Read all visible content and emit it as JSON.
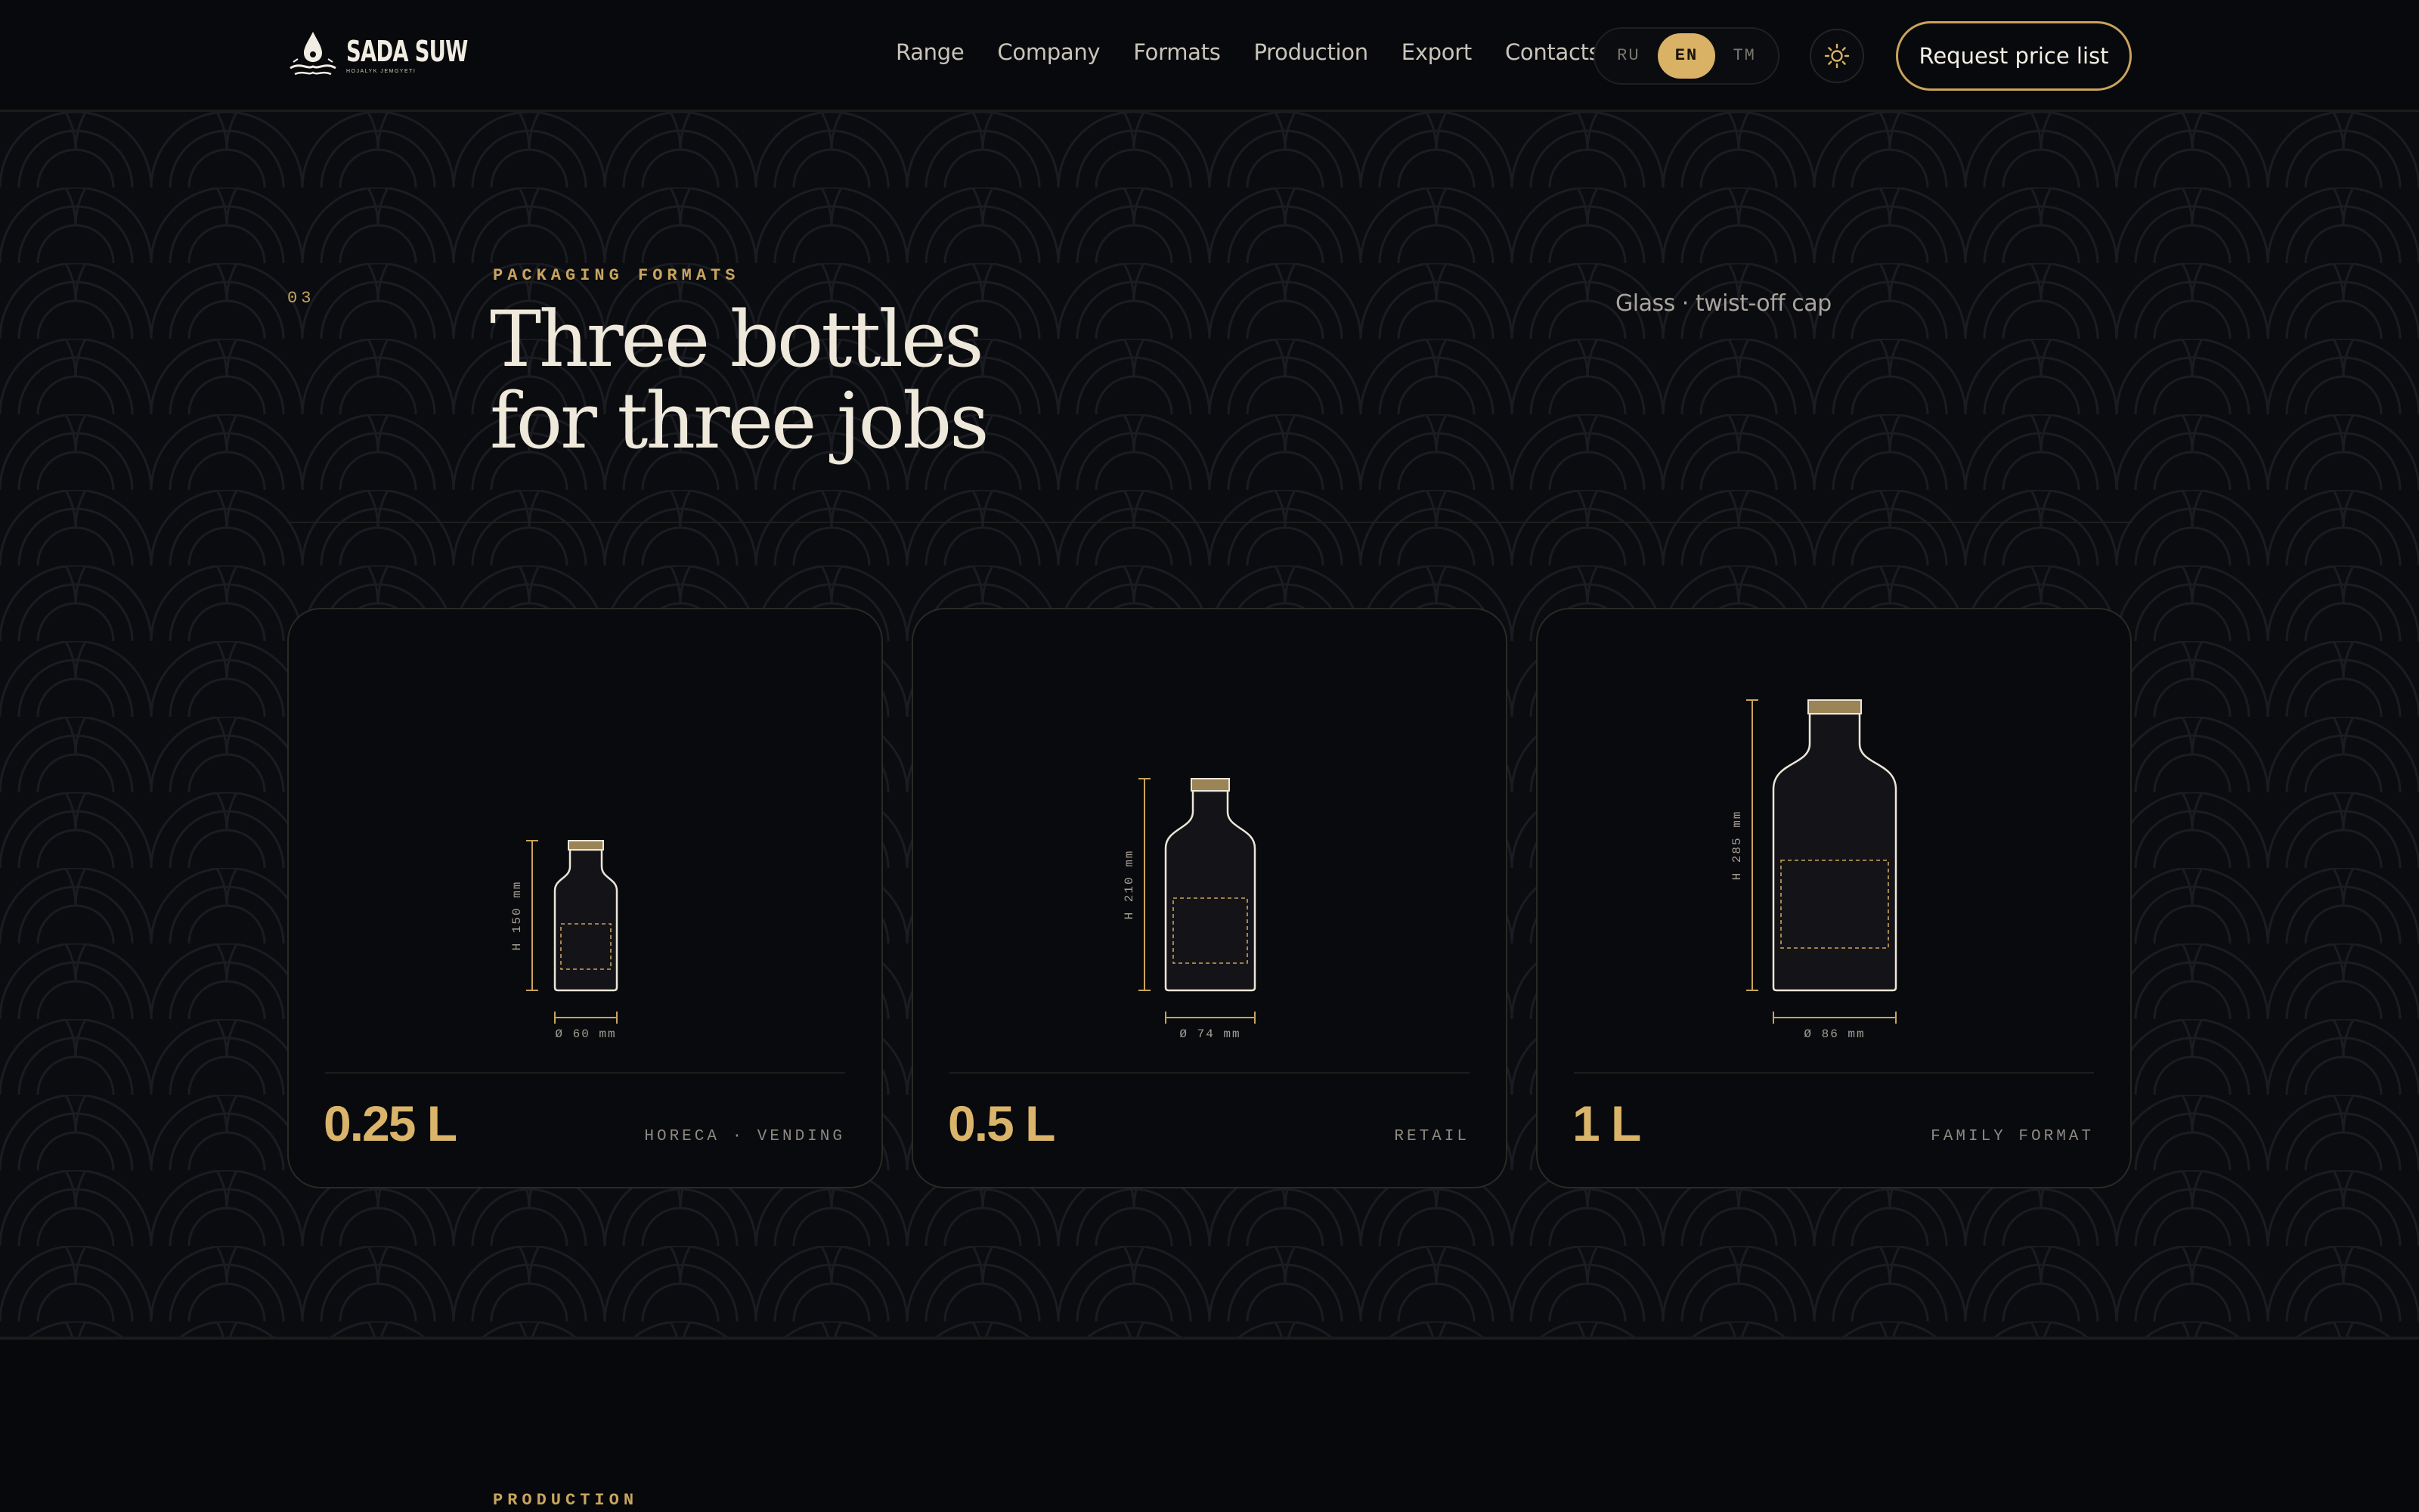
{
  "brand": {
    "name": "SADA SUW",
    "tagline": "HOJALYK JEMGYETI"
  },
  "nav": {
    "items": [
      {
        "label": "Range"
      },
      {
        "label": "Company"
      },
      {
        "label": "Formats"
      },
      {
        "label": "Production"
      },
      {
        "label": "Export"
      },
      {
        "label": "Contacts"
      }
    ]
  },
  "lang": {
    "options": [
      "RU",
      "EN",
      "TM"
    ],
    "active": "EN"
  },
  "theme_toggle": {
    "icon": "sun-icon"
  },
  "cta": {
    "label": "Request price list"
  },
  "section": {
    "number": "03",
    "eyebrow": "PACKAGING FORMATS",
    "title_line1": "Three bottles",
    "title_line2": "for three jobs",
    "note": "Glass · twist-off cap"
  },
  "formats": [
    {
      "volume": "0.25 L",
      "use": "HORECA · VENDING",
      "height_label": "H 150 mm",
      "diameter_label": "Ø 60 mm"
    },
    {
      "volume": "0.5 L",
      "use": "RETAIL",
      "height_label": "H 210 mm",
      "diameter_label": "Ø 74 mm"
    },
    {
      "volume": "1 L",
      "use": "FAMILY FORMAT",
      "height_label": "H 285 mm",
      "diameter_label": "Ø 86 mm"
    }
  ],
  "next_section": {
    "eyebrow": "PRODUCTION"
  },
  "colors": {
    "accent": "#d9b266",
    "background": "#08090c",
    "text": "#efe9dc"
  }
}
